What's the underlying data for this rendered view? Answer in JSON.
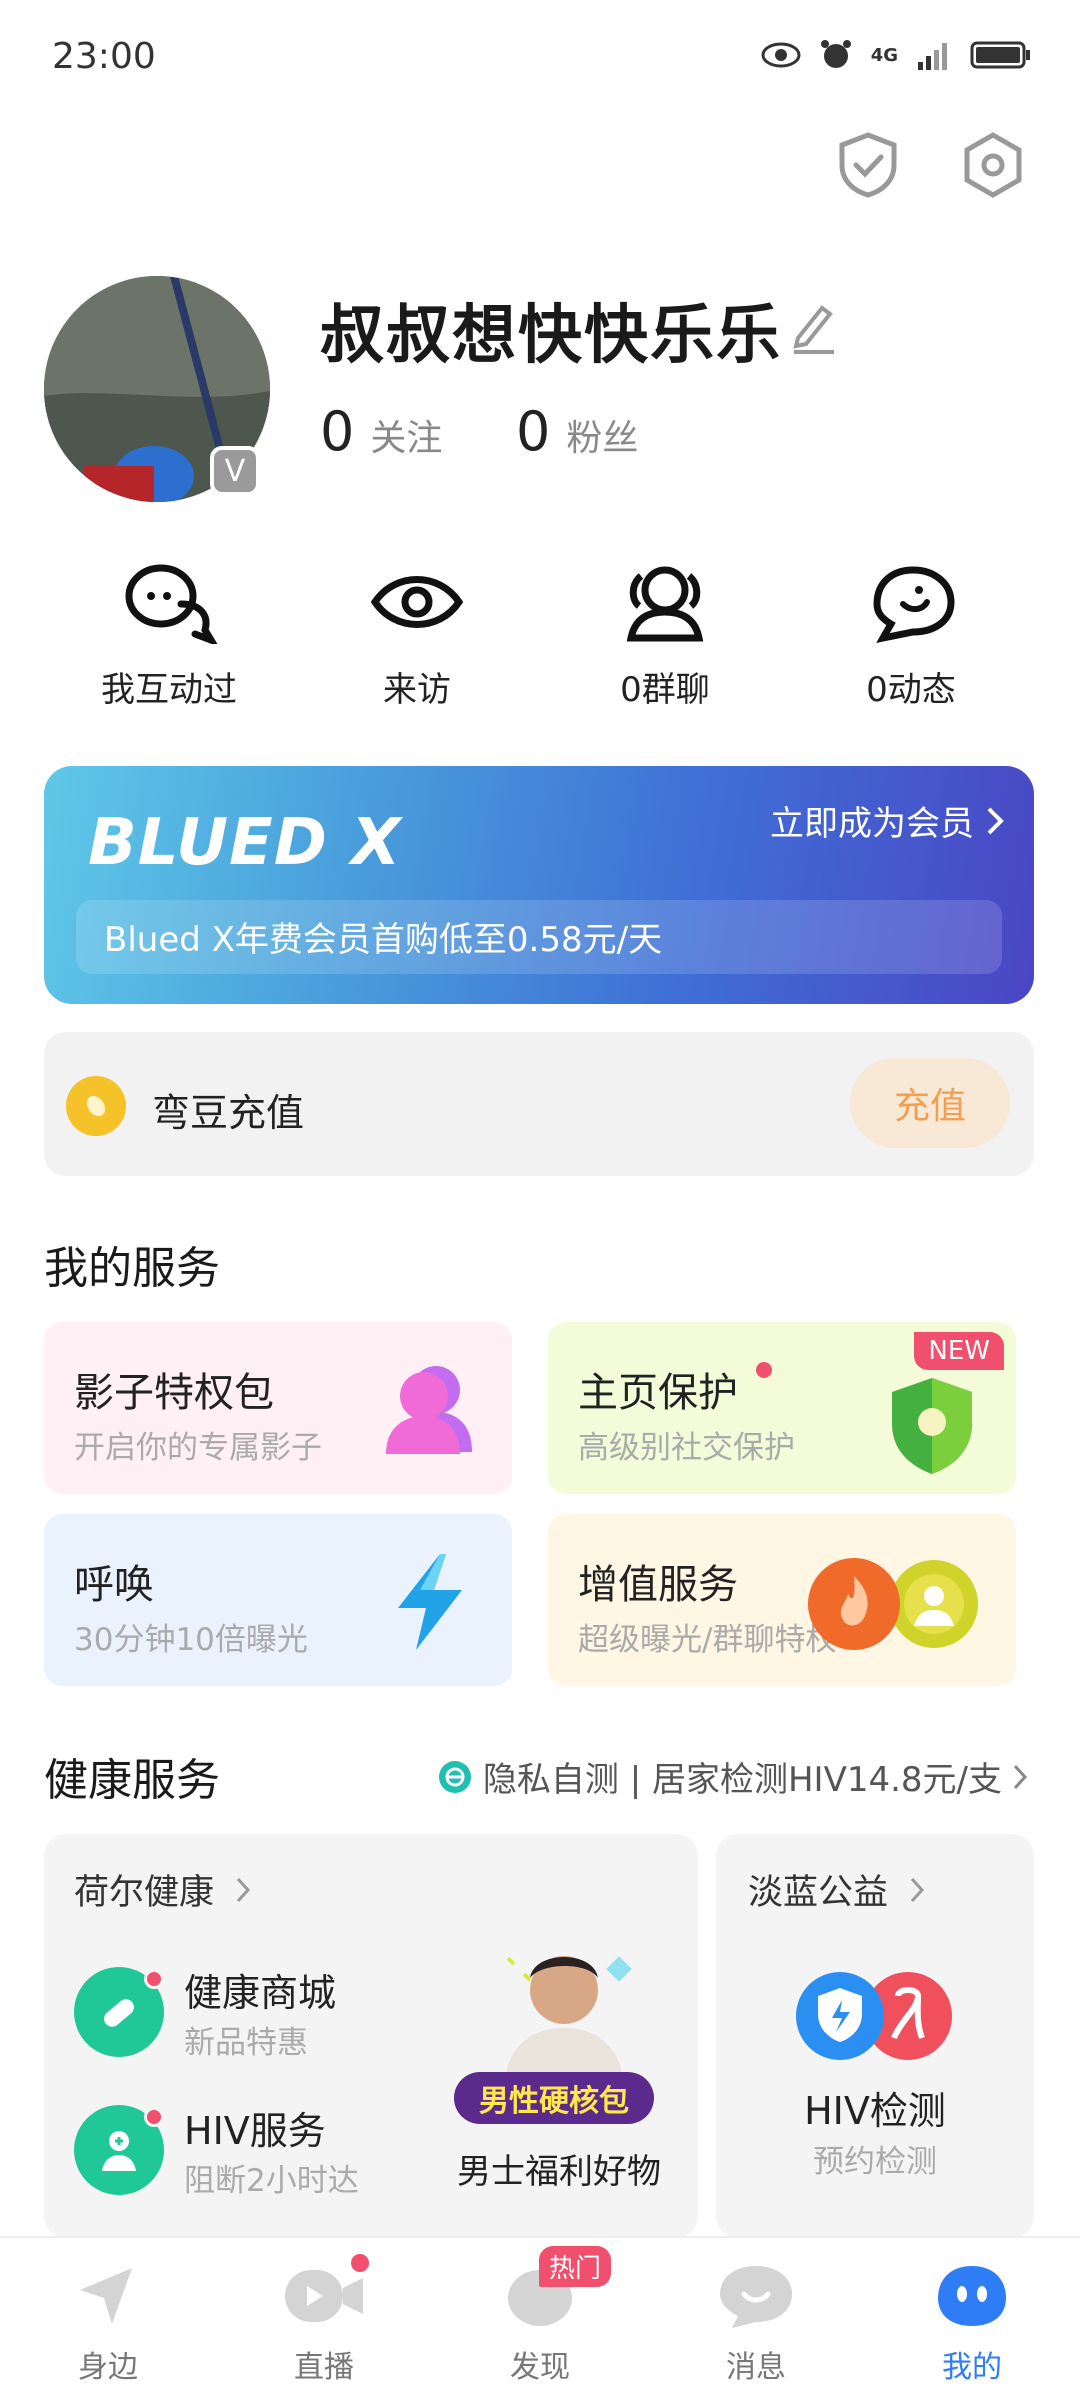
{
  "status_bar": {
    "time": "23:00",
    "network": "4G"
  },
  "profile": {
    "nickname": "叔叔想快快乐乐",
    "following_count": "0",
    "following_label": "关注",
    "followers_count": "0",
    "followers_label": "粉丝",
    "badge": "V"
  },
  "quick_actions": [
    {
      "label": "我互动过",
      "icon": "chat-bubbles-icon"
    },
    {
      "label": "来访",
      "icon": "eye-icon"
    },
    {
      "label": "0群聊",
      "icon": "group-icon"
    },
    {
      "label": "0动态",
      "icon": "moments-icon"
    }
  ],
  "vip_banner": {
    "logo": "BLUED X",
    "cta": "立即成为会员",
    "description": "Blued X年费会员首购低至0.58元/天"
  },
  "recharge": {
    "label": "弯豆充值",
    "button": "充值"
  },
  "my_services": {
    "title": "我的服务",
    "items": [
      {
        "title": "影子特权包",
        "subtitle": "开启你的专属影子"
      },
      {
        "title": "主页保护",
        "subtitle": "高级别社交保护",
        "badge": "NEW"
      },
      {
        "title": "呼唤",
        "subtitle": "30分钟10倍曝光"
      },
      {
        "title": "增值服务",
        "subtitle": "超级曝光/群聊特权"
      }
    ]
  },
  "health": {
    "title": "健康服务",
    "subtitle": "隐私自测 | 居家检测HIV14.8元/支",
    "left_card": {
      "header": "荷尔健康",
      "items": [
        {
          "title": "健康商城",
          "subtitle": "新品特惠"
        },
        {
          "title": "HIV服务",
          "subtitle": "阻断2小时达"
        }
      ],
      "promo_tag": "男性硬核包",
      "promo_caption": "男士福利好物"
    },
    "right_card": {
      "header": "淡蓝公益",
      "title": "HIV检测",
      "subtitle": "预约检测"
    }
  },
  "tab_bar": [
    {
      "label": "身边"
    },
    {
      "label": "直播"
    },
    {
      "label": "发现",
      "badge": "热门"
    },
    {
      "label": "消息"
    },
    {
      "label": "我的",
      "active": true
    }
  ],
  "colors": {
    "accent_blue": "#2f7df6",
    "badge_red": "#f0506e",
    "recharge_orange": "#f0a050",
    "health_green": "#1fc896"
  }
}
